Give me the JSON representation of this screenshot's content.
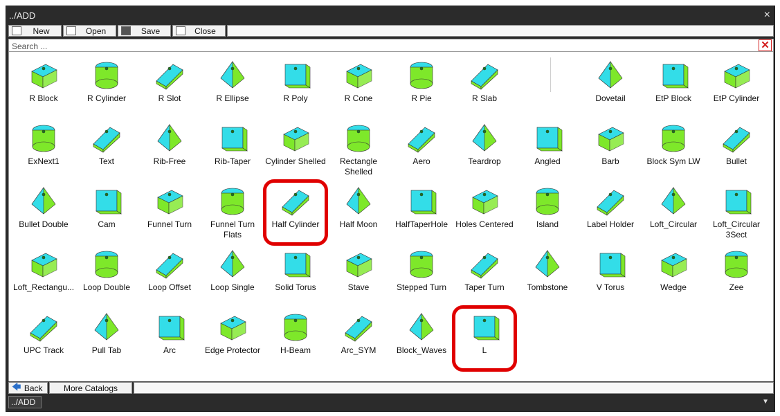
{
  "window": {
    "title": "../ADD",
    "close_glyph": "×"
  },
  "toolbar": {
    "new_label": "New",
    "open_label": "Open",
    "save_label": "Save",
    "close_label": "Close"
  },
  "search": {
    "placeholder": "Search ...",
    "value": ""
  },
  "footer": {
    "back_label": "Back",
    "more_catalogs_label": "More Catalogs"
  },
  "status": {
    "path": "../ADD"
  },
  "colors": {
    "accent_green": "#7ee82a",
    "accent_cyan": "#33dde8",
    "highlight_red": "#e00000"
  },
  "items": [
    {
      "label": "R Block",
      "icon": "r-block-icon"
    },
    {
      "label": "R Cylinder",
      "icon": "r-cylinder-icon"
    },
    {
      "label": "R Slot",
      "icon": "r-slot-icon"
    },
    {
      "label": "R Ellipse",
      "icon": "r-ellipse-icon"
    },
    {
      "label": "R Poly",
      "icon": "r-poly-icon"
    },
    {
      "label": "R Cone",
      "icon": "r-cone-icon"
    },
    {
      "label": "R Pie",
      "icon": "r-pie-icon"
    },
    {
      "label": "R Slab",
      "icon": "r-slab-icon"
    },
    {
      "label": "Dovetail",
      "icon": "dovetail-icon"
    },
    {
      "label": "EtP Block",
      "icon": "etp-block-icon"
    },
    {
      "label": "EtP Cylinder",
      "icon": "etp-cylinder-icon"
    },
    {
      "label": "ExNext1",
      "icon": "exnext1-icon"
    },
    {
      "label": "Text",
      "icon": "text-icon"
    },
    {
      "label": "Rib-Free",
      "icon": "rib-free-icon"
    },
    {
      "label": "Rib-Taper",
      "icon": "rib-taper-icon"
    },
    {
      "label": "Cylinder Shelled",
      "icon": "cylinder-shelled-icon"
    },
    {
      "label": "Rectangle Shelled",
      "icon": "rectangle-shelled-icon"
    },
    {
      "label": "Aero",
      "icon": "aero-icon"
    },
    {
      "label": "Teardrop",
      "icon": "teardrop-icon"
    },
    {
      "label": "Angled",
      "icon": "angled-icon"
    },
    {
      "label": "Barb",
      "icon": "barb-icon"
    },
    {
      "label": "Block Sym LW",
      "icon": "block-sym-lw-icon"
    },
    {
      "label": "Bullet",
      "icon": "bullet-icon"
    },
    {
      "label": "Bullet Double",
      "icon": "bullet-double-icon"
    },
    {
      "label": "Cam",
      "icon": "cam-icon"
    },
    {
      "label": "Funnel Turn",
      "icon": "funnel-turn-icon"
    },
    {
      "label": "Funnel Turn Flats",
      "icon": "funnel-turn-flats-icon"
    },
    {
      "label": "Half Cylinder",
      "icon": "half-cylinder-icon"
    },
    {
      "label": "Half Moon",
      "icon": "half-moon-icon"
    },
    {
      "label": "HalfTaperHole",
      "icon": "half-taper-hole-icon"
    },
    {
      "label": "Holes Centered",
      "icon": "holes-centered-icon"
    },
    {
      "label": "Island",
      "icon": "island-icon"
    },
    {
      "label": "Label Holder",
      "icon": "label-holder-icon"
    },
    {
      "label": "Loft_Circular",
      "icon": "loft-circular-icon"
    },
    {
      "label": "Loft_Circular 3Sect",
      "icon": "loft-circular-3sect-icon"
    },
    {
      "label": "Loft_Rectangu...",
      "icon": "loft-rectangular-icon"
    },
    {
      "label": "Loop Double",
      "icon": "loop-double-icon"
    },
    {
      "label": "Loop Offset",
      "icon": "loop-offset-icon"
    },
    {
      "label": "Loop Single",
      "icon": "loop-single-icon"
    },
    {
      "label": "Solid Torus",
      "icon": "solid-torus-icon"
    },
    {
      "label": "Stave",
      "icon": "stave-icon"
    },
    {
      "label": "Stepped Turn",
      "icon": "stepped-turn-icon"
    },
    {
      "label": "Taper Turn",
      "icon": "taper-turn-icon"
    },
    {
      "label": "Tombstone",
      "icon": "tombstone-icon"
    },
    {
      "label": "V Torus",
      "icon": "v-torus-icon"
    },
    {
      "label": "Wedge",
      "icon": "wedge-icon"
    },
    {
      "label": "Zee",
      "icon": "zee-icon"
    },
    {
      "label": "UPC Track",
      "icon": "upc-track-icon"
    },
    {
      "label": "Pull Tab",
      "icon": "pull-tab-icon"
    },
    {
      "label": "Arc",
      "icon": "arc-icon"
    },
    {
      "label": "Edge Protector",
      "icon": "edge-protector-icon"
    },
    {
      "label": "H-Beam",
      "icon": "h-beam-icon"
    },
    {
      "label": "Arc_SYM",
      "icon": "arc-sym-icon"
    },
    {
      "label": "Block_Waves",
      "icon": "block-waves-icon"
    },
    {
      "label": "L",
      "icon": "l-icon"
    }
  ],
  "highlighted": [
    "Half Cylinder",
    "L"
  ]
}
